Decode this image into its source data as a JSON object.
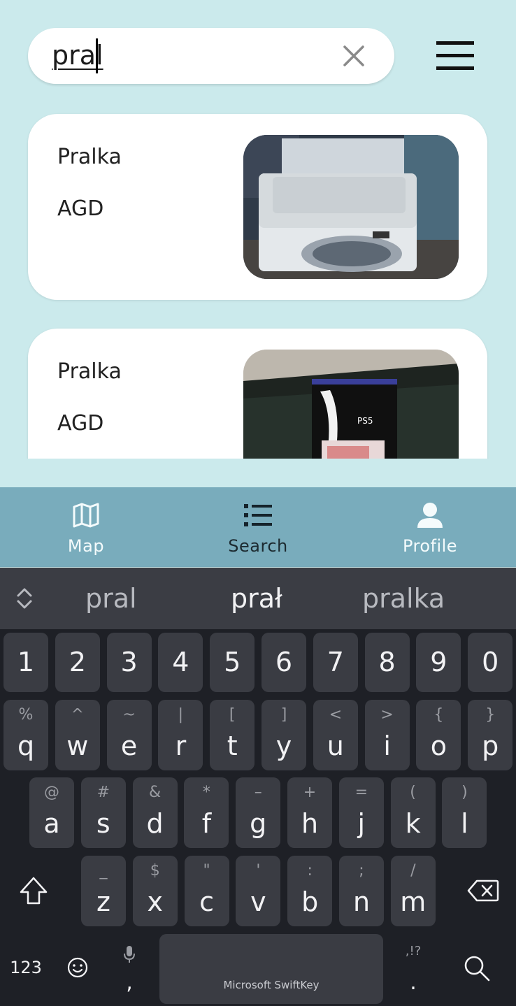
{
  "search": {
    "query": "pral"
  },
  "icons": {
    "clear": "close-icon",
    "menu": "hamburger-menu-icon",
    "map": "map-icon",
    "search": "list-icon",
    "profile": "person-icon"
  },
  "results": [
    {
      "title": "Pralka",
      "category": "AGD",
      "image": "washing-machine-photo"
    },
    {
      "title": "Pralka",
      "category": "AGD",
      "image": "ps5-box-in-dumpster-photo"
    }
  ],
  "bottom_nav": {
    "items": [
      {
        "label": "Map",
        "active": false
      },
      {
        "label": "Search",
        "active": true
      },
      {
        "label": "Profile",
        "active": false
      }
    ]
  },
  "keyboard": {
    "suggestions": [
      "pral",
      "prał",
      "pralka"
    ],
    "numbers": [
      "1",
      "2",
      "3",
      "4",
      "5",
      "6",
      "7",
      "8",
      "9",
      "0"
    ],
    "row1": [
      {
        "k": "q",
        "h": "%"
      },
      {
        "k": "w",
        "h": "^"
      },
      {
        "k": "e",
        "h": "~"
      },
      {
        "k": "r",
        "h": "|"
      },
      {
        "k": "t",
        "h": "["
      },
      {
        "k": "y",
        "h": "]"
      },
      {
        "k": "u",
        "h": "<"
      },
      {
        "k": "i",
        "h": ">"
      },
      {
        "k": "o",
        "h": "{"
      },
      {
        "k": "p",
        "h": "}"
      }
    ],
    "row2": [
      {
        "k": "a",
        "h": "@"
      },
      {
        "k": "s",
        "h": "#"
      },
      {
        "k": "d",
        "h": "&"
      },
      {
        "k": "f",
        "h": "*"
      },
      {
        "k": "g",
        "h": "–"
      },
      {
        "k": "h",
        "h": "+"
      },
      {
        "k": "j",
        "h": "="
      },
      {
        "k": "k",
        "h": "("
      },
      {
        "k": "l",
        "h": ")"
      }
    ],
    "row3": [
      {
        "k": "z",
        "h": "_"
      },
      {
        "k": "x",
        "h": "$"
      },
      {
        "k": "c",
        "h": "\""
      },
      {
        "k": "v",
        "h": "'"
      },
      {
        "k": "b",
        "h": ":"
      },
      {
        "k": "n",
        "h": ";"
      },
      {
        "k": "m",
        "h": "/"
      }
    ],
    "symbols_key": "123",
    "comma_key": ",",
    "period_key": ".",
    "period_hint": ",!?",
    "space_label": "Microsoft SwiftKey"
  },
  "colors": {
    "background": "#cbeaec",
    "nav_bar": "#79acbc",
    "keyboard_bg": "#1e2026",
    "key_bg": "#3a3c43"
  }
}
